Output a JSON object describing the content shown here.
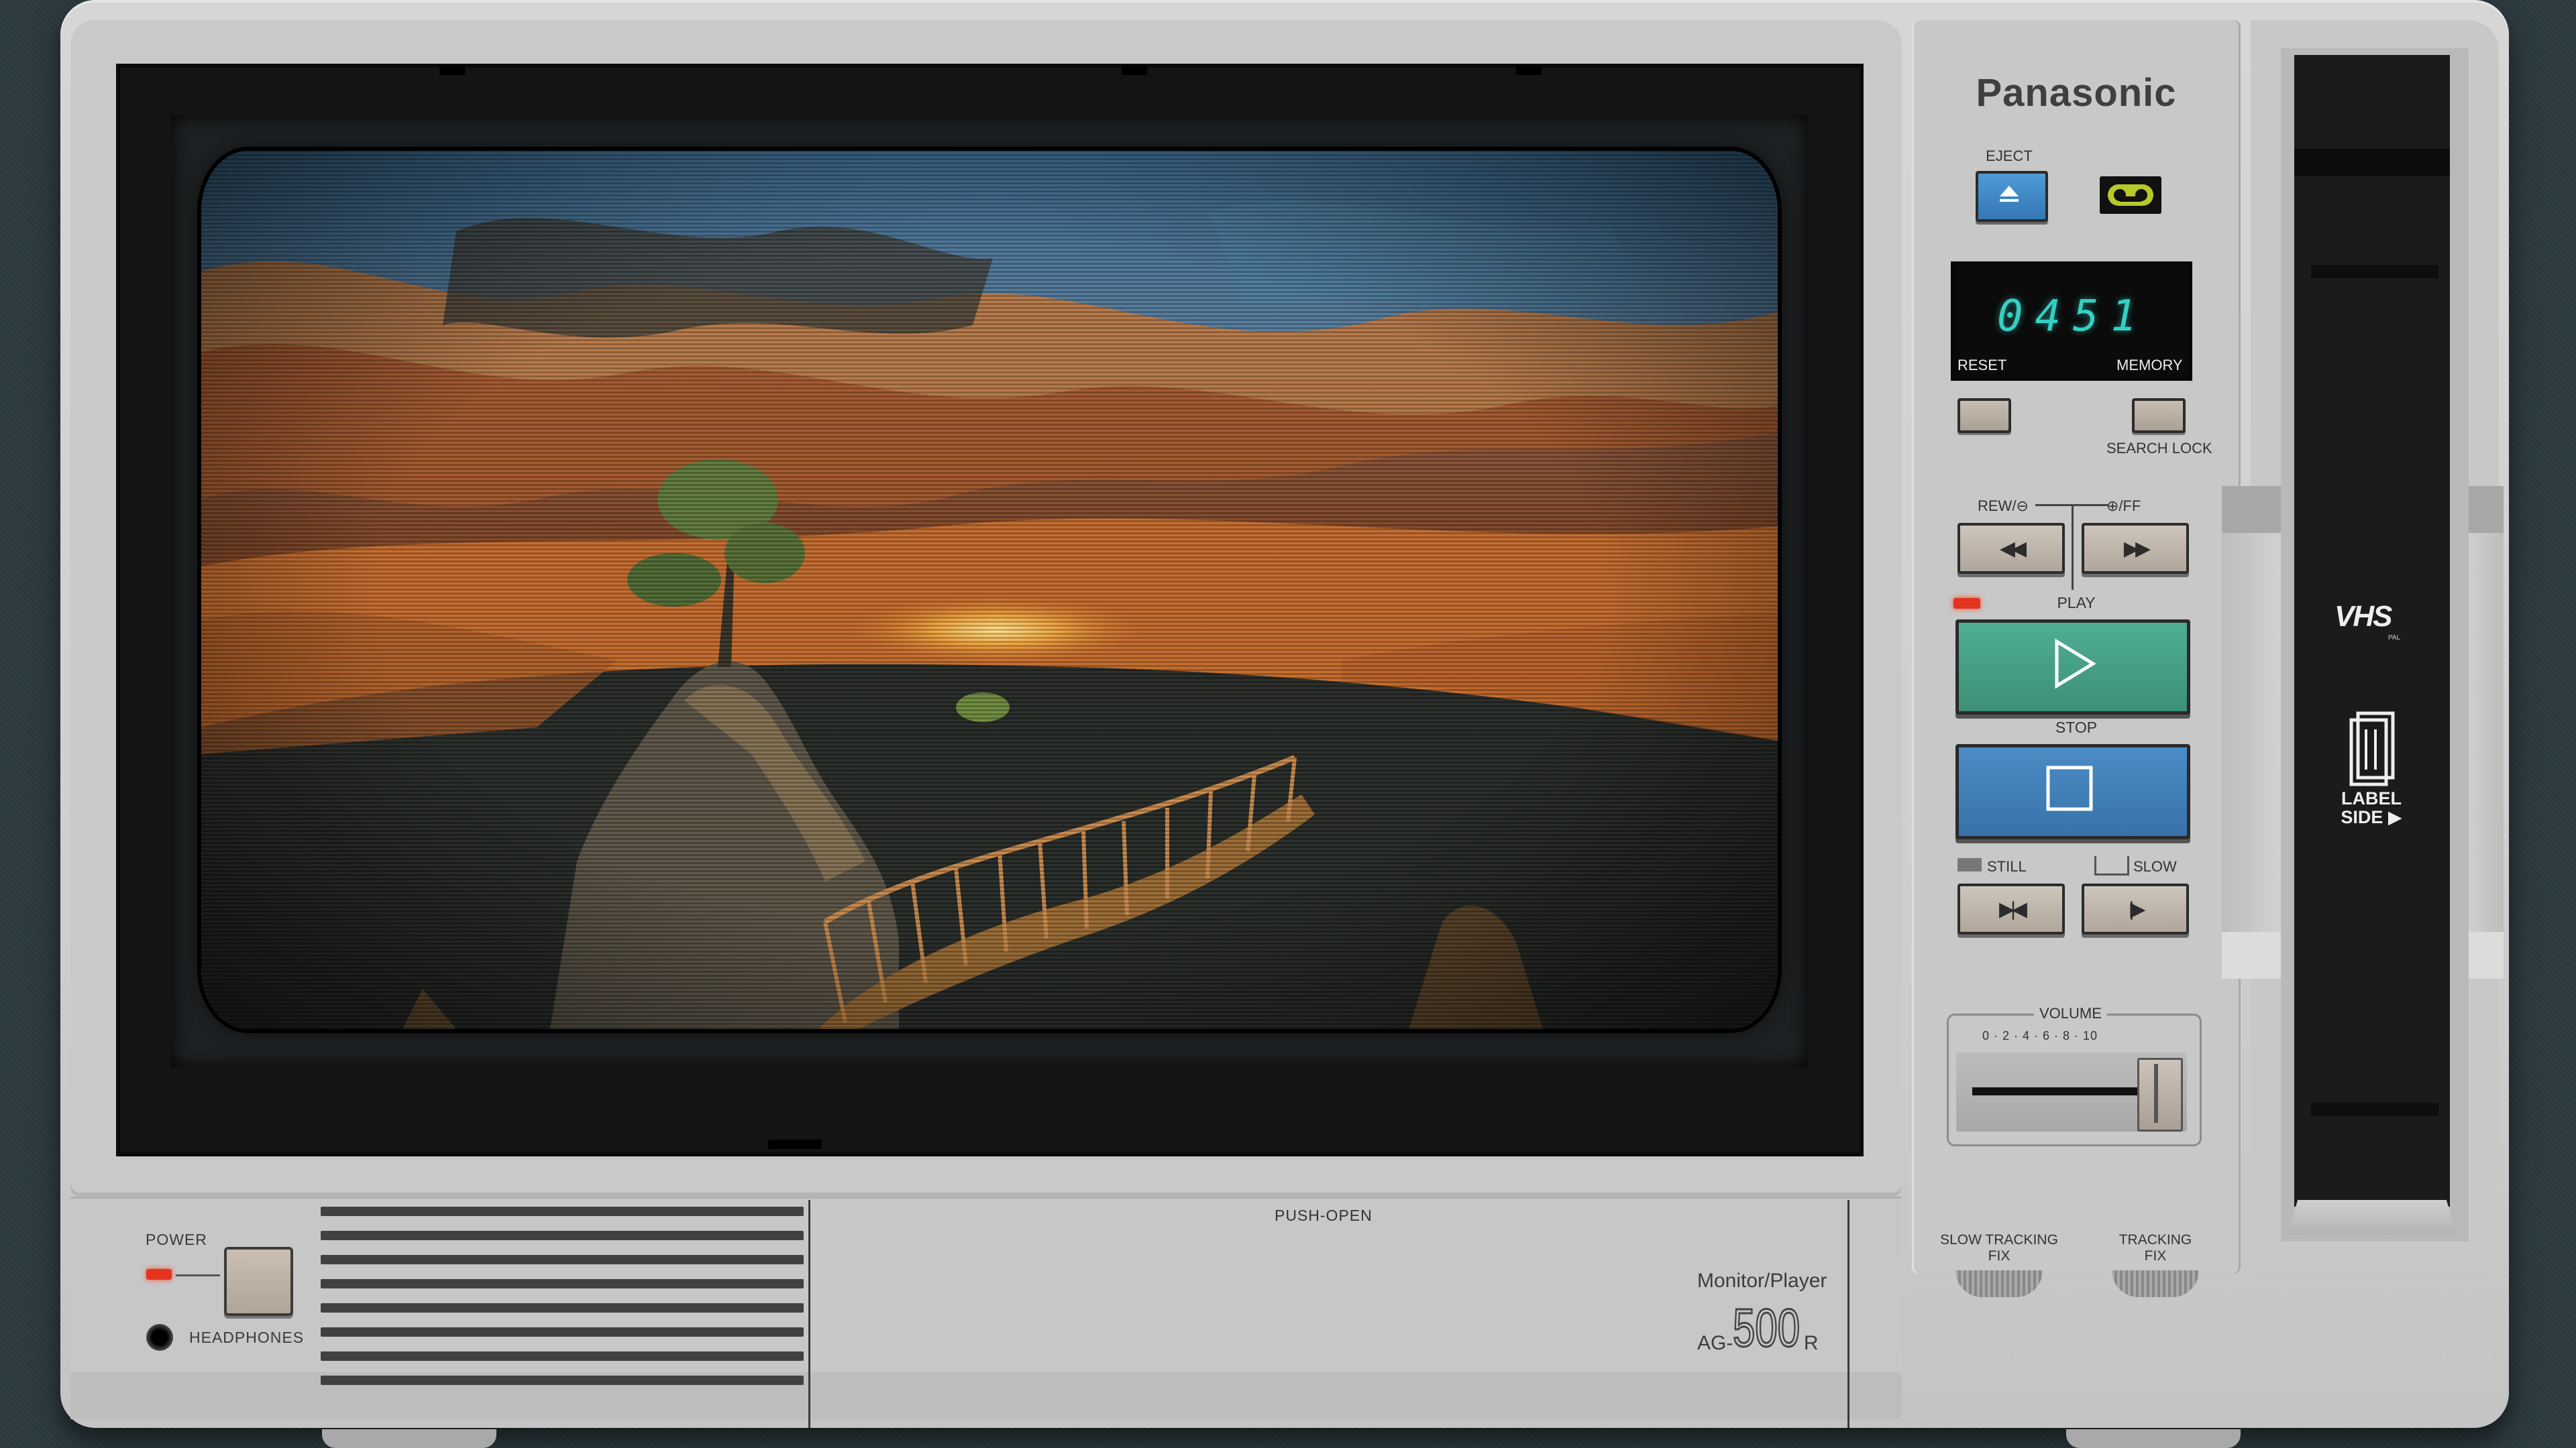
{
  "brand": "Panasonic",
  "eject": {
    "label": "EJECT"
  },
  "counter": {
    "digits": "0451",
    "reset_label": "RESET",
    "memory_label": "MEMORY"
  },
  "search_lock_label": "SEARCH LOCK",
  "transport": {
    "rew_label": "REW/⊖",
    "ff_label": "⊕/FF",
    "rew_glyph": "◀◀",
    "ff_glyph": "▶▶",
    "play_label": "PLAY",
    "stop_label": "STOP",
    "still_label": "STILL",
    "slow_label": "SLOW",
    "still_glyph": "▶|◀",
    "slow_glyph": "|▶"
  },
  "volume": {
    "label": "VOLUME",
    "scale": "0 · 2 · 4 · 6 · 8 · 10",
    "level": 0.88
  },
  "tracking": {
    "slow_tracking_label": "SLOW TRACKING",
    "slow_tracking_sub": "FIX",
    "tracking_label": "TRACKING",
    "tracking_sub": "FIX"
  },
  "front": {
    "power_label": "POWER",
    "headphones_label": "HEADPHONES",
    "push_open_label": "PUSH-OPEN",
    "model_line": "Monitor/Player",
    "model_prefix": "AG-",
    "model_number": "500",
    "model_suffix": "R"
  },
  "cassette": {
    "vhs_logo": "VHS",
    "vhs_sub": "PAL",
    "label_side_1": "LABEL",
    "label_side_2": "SIDE ▶"
  },
  "colors": {
    "play": "#4fae94",
    "stop": "#4b8cc7",
    "eject": "#4f9bd6",
    "counter_digits": "#35d0c4",
    "led": "#e3341f"
  }
}
